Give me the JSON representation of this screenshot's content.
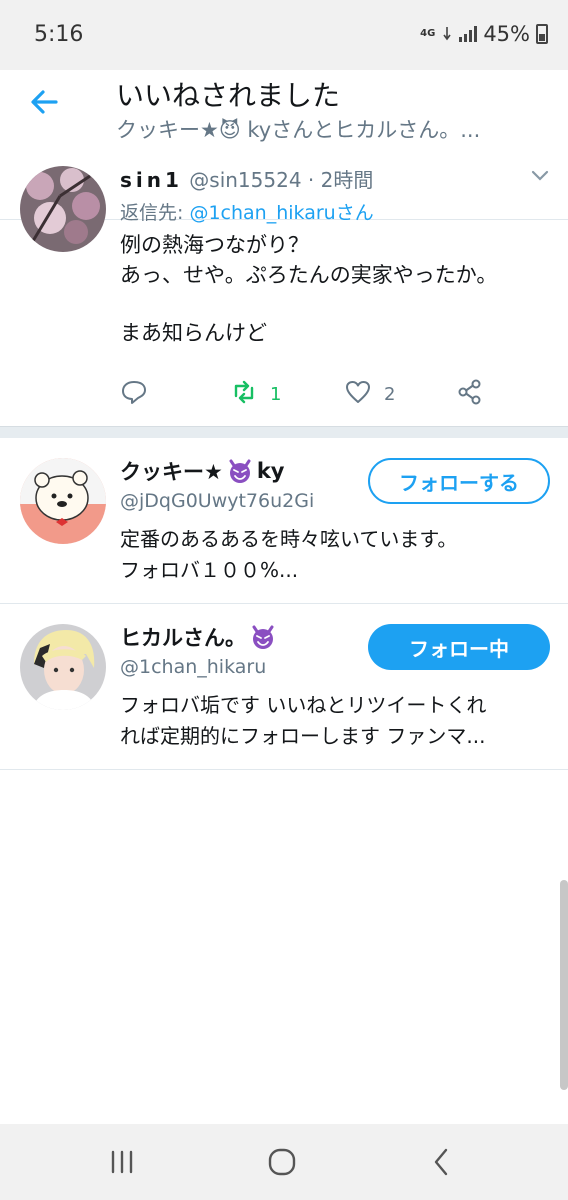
{
  "status_bar": {
    "time": "5:16",
    "network": "4G",
    "battery": "45%"
  },
  "header": {
    "title": "いいねされました",
    "subtitle": "クッキー★😈 kyさんとヒカルさん。..."
  },
  "tweet": {
    "name": "sin1",
    "handle": "@sin15524",
    "separator": "·",
    "time": "2時間",
    "reply_prefix": "返信先:",
    "reply_to": "@1chan_hikaruさん",
    "text_line1": "例の熱海つながり？",
    "text_line2": "あっ、せや。ぷろたんの実家やったか。",
    "text_line3": "まあ知らんけど",
    "retweet_count": "1",
    "like_count": "2",
    "colors": {
      "retweet": "#17bf63",
      "icon": "#657786"
    }
  },
  "users": [
    {
      "name": "クッキー★",
      "name_suffix": "ky",
      "handle": "@jDqG0Uwyt76u2Gi",
      "bio_line1": "定番のあるあるを時々呟いています。",
      "bio_line2": "フォロバ１００%...",
      "button": "フォローする"
    },
    {
      "name": "ヒカルさん。",
      "name_suffix": "",
      "handle": "@1chan_hikaru",
      "bio_line1": "フォロバ垢です いいねとリツイートくれ",
      "bio_line2": "れば定期的にフォローします ファンマ...",
      "button": "フォロー中"
    }
  ],
  "accent_color": "#1da1f2"
}
